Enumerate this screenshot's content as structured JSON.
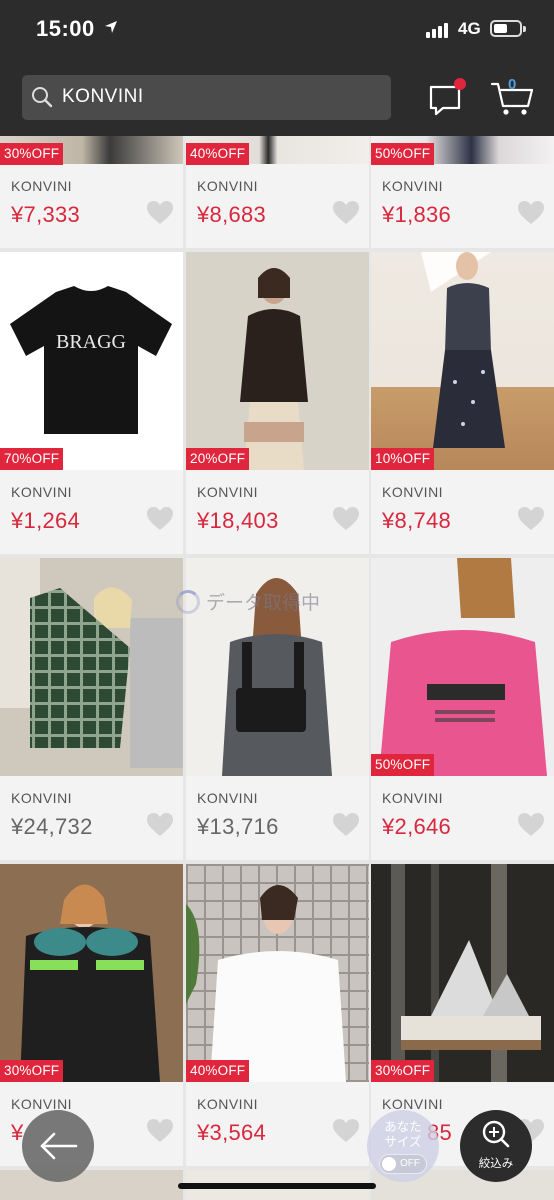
{
  "status_bar": {
    "time": "15:00",
    "network": "4G"
  },
  "header": {
    "search_value": "KONVINI",
    "cart_count": "0"
  },
  "loading_text": "データ取得中",
  "products": [
    {
      "brand": "KONVINI",
      "price": "¥7,333",
      "discount": "30%OFF"
    },
    {
      "brand": "KONVINI",
      "price": "¥8,683",
      "discount": "40%OFF"
    },
    {
      "brand": "KONVINI",
      "price": "¥1,836",
      "discount": "50%OFF"
    },
    {
      "brand": "KONVINI",
      "price": "¥1,264",
      "discount": "70%OFF"
    },
    {
      "brand": "KONVINI",
      "price": "¥18,403",
      "discount": "20%OFF"
    },
    {
      "brand": "KONVINI",
      "price": "¥8,748",
      "discount": "10%OFF"
    },
    {
      "brand": "KONVINI",
      "price": "¥24,732",
      "discount": ""
    },
    {
      "brand": "KONVINI",
      "price": "¥13,716",
      "discount": ""
    },
    {
      "brand": "KONVINI",
      "price": "¥2,646",
      "discount": "50%OFF"
    },
    {
      "brand": "KONVINI",
      "price": "¥",
      "discount": "30%OFF"
    },
    {
      "brand": "KONVINI",
      "price": "¥3,564",
      "discount": "40%OFF"
    },
    {
      "brand": "KONVINI",
      "price": "85",
      "discount": "30%OFF"
    }
  ],
  "tshirt_print": "BRAGG",
  "floating": {
    "size_label_line1": "あなた",
    "size_label_line2": "サイズ",
    "size_toggle": "OFF",
    "filter_label": "絞込み"
  },
  "colors": {
    "sale_red": "#e0263c",
    "header_bg": "#2c2c2c",
    "cart_blue": "#4d9fe0"
  }
}
